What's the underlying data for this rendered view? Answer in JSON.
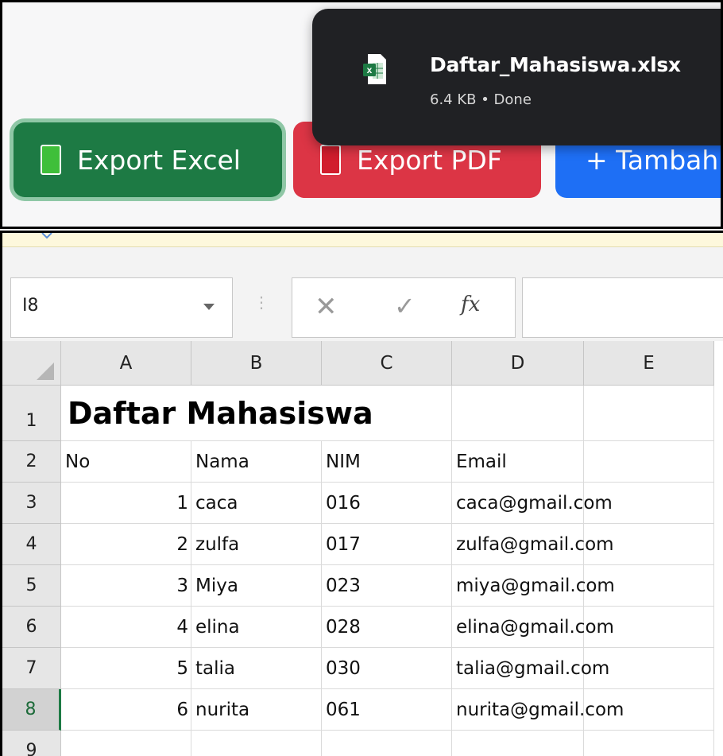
{
  "buttons": {
    "excel": "Export Excel",
    "pdf": "Export PDF",
    "add": "+ Tambah"
  },
  "download": {
    "filename": "Daftar_Mahasiswa.xlsx",
    "meta": "6.4 KB • Done"
  },
  "excel": {
    "name_box": "I8",
    "formula_fx": "fx",
    "formula_value": "",
    "columns": [
      "A",
      "B",
      "C",
      "D",
      "E"
    ],
    "row_numbers": [
      "1",
      "2",
      "3",
      "4",
      "5",
      "6",
      "7",
      "8",
      "9"
    ],
    "title": "Daftar Mahasiswa",
    "headers": [
      "No",
      "Nama",
      "NIM",
      "Email"
    ],
    "rows": [
      [
        "1",
        "caca",
        "016",
        "caca@gmail.com"
      ],
      [
        "2",
        "zulfa",
        "017",
        "zulfa@gmail.com"
      ],
      [
        "3",
        "Miya",
        "023",
        "miya@gmail.com"
      ],
      [
        "4",
        "elina",
        "028",
        "elina@gmail.com"
      ],
      [
        "5",
        "talia",
        "030",
        "talia@gmail.com"
      ],
      [
        "6",
        "nurita",
        "061",
        "nurita@gmail.com"
      ]
    ]
  },
  "colors": {
    "excel_green": "#1d7a44",
    "pdf_red": "#dc3545",
    "add_blue": "#1e6ff5",
    "popup_bg": "#202124"
  },
  "icons": {
    "excel_file": "excel-file-icon",
    "excel_button": "green-book-icon",
    "pdf_button": "red-book-icon"
  }
}
